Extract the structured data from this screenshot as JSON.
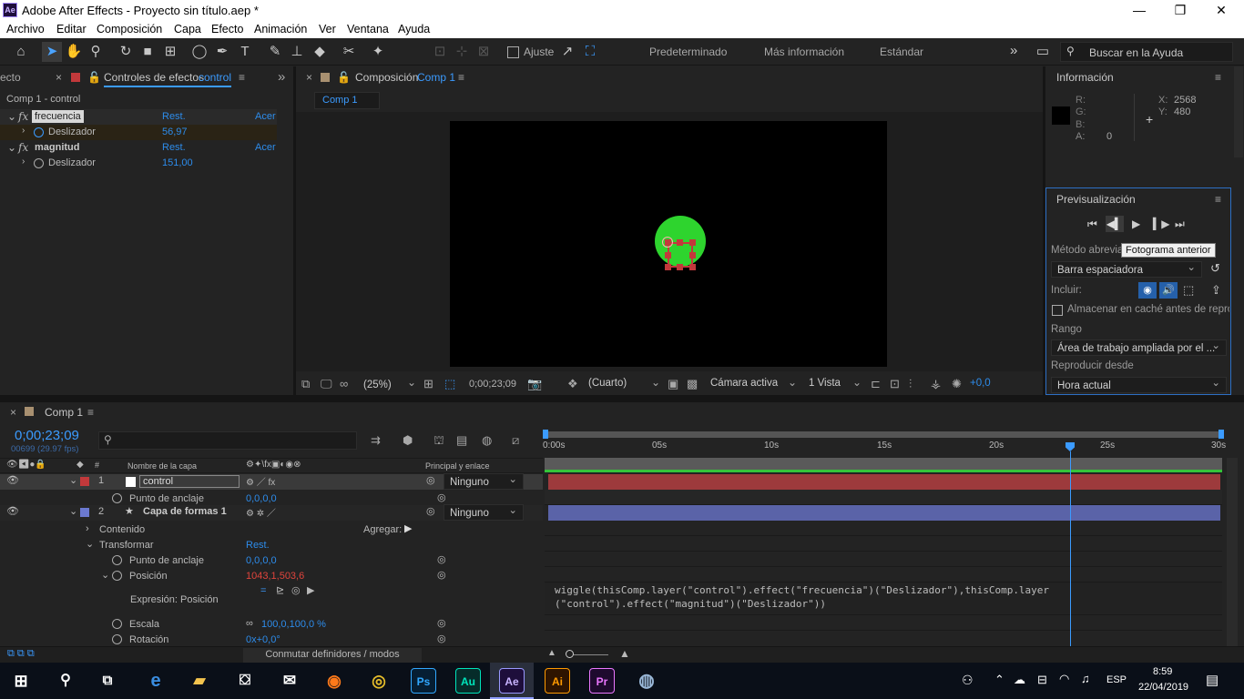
{
  "titlebar": {
    "logo": "Ae",
    "title": "Adobe After Effects - Proyecto sin título.aep *",
    "minimize": "—",
    "maximize": "❐",
    "close": "✕"
  },
  "menu": [
    "Archivo",
    "Editar",
    "Composición",
    "Capa",
    "Efecto",
    "Animación",
    "Ver",
    "Ventana",
    "Ayuda"
  ],
  "toolbar": {
    "snap_label": "Ajuste",
    "workspaces": [
      "Predeterminado",
      "Más información",
      "Estándar"
    ],
    "more": "»",
    "search_placeholder": "Buscar en la Ayuda"
  },
  "effects_panel": {
    "tab_left": "ecto",
    "tab_label": "Controles de efectos",
    "tab_layer": "control",
    "header": "Comp 1 - control",
    "effects": [
      {
        "name": "frecuencia",
        "reset": "Rest.",
        "about": "Acer",
        "param": "Deslizador",
        "value": "56,97"
      },
      {
        "name": "magnitud",
        "reset": "Rest.",
        "about": "Acer",
        "param": "Deslizador",
        "value": "151,00"
      }
    ]
  },
  "comp_panel": {
    "tab_label": "Composición",
    "tab_name": "Comp 1",
    "sub_tab": "Comp 1",
    "zoom": "(25%)",
    "timecode": "0;00;23;09",
    "resolution": "(Cuarto)",
    "camera": "Cámara activa",
    "views": "1 Vista",
    "exposure": "+0,0"
  },
  "info_panel": {
    "title": "Información",
    "r": "R:",
    "g": "G:",
    "b": "B:",
    "a": "A:",
    "a_val": "0",
    "x": "X:",
    "x_val": "2568",
    "y": "Y:",
    "y_val": "480"
  },
  "preview_panel": {
    "title": "Previsualización",
    "shortcut_label": "Método abrevia",
    "tooltip": "Fotograma anterior",
    "shortcut_value": "Barra espaciadora",
    "include_label": "Incluir:",
    "cache_label": "Almacenar en caché antes de reprodu",
    "range_label": "Rango",
    "range_value": "Área de trabajo ampliada por el ...",
    "play_from_label": "Reproducir desde",
    "play_from_value": "Hora actual"
  },
  "timeline": {
    "tab_name": "Comp 1",
    "timecode": "0;00;23;09",
    "fps": "00699 (29.97 fps)",
    "col_layer_name": "Nombre de la capa",
    "col_parent": "Principal y enlace",
    "ruler": [
      "0:00s",
      "05s",
      "10s",
      "15s",
      "20s",
      "25s",
      "30s"
    ],
    "layers": [
      {
        "num": "1",
        "name": "control",
        "parent": "Ninguno",
        "color": "#c2393b"
      },
      {
        "num": "2",
        "name": "Capa de formas 1",
        "parent": "Ninguno",
        "color": "#6b79d0"
      }
    ],
    "rows": {
      "anchor1": "Punto de anclaje",
      "anchor1_val": "0,0,0,0",
      "contents": "Contenido",
      "add": "Agregar:",
      "transform": "Transformar",
      "transform_reset": "Rest.",
      "anchor2": "Punto de anclaje",
      "anchor2_val": "0,0,0,0",
      "position": "Posición",
      "position_val": "1043,1,503,6",
      "expr_label": "Expresión: Posición",
      "scale": "Escala",
      "scale_val": "100,0,100,0 %",
      "rotation": "Rotación",
      "rotation_val": "0x+0,0°"
    },
    "expression": "wiggle(thisComp.layer(\"control\").effect(\"frecuencia\")(\"Deslizador\"),thisComp.layer\n(\"control\").effect(\"magnitud\")(\"Deslizador\"))",
    "toggle_label": "Conmutar definidores / modos"
  },
  "taskbar": {
    "apps": [
      "Ps",
      "Au",
      "Ae",
      "Ai",
      "Pr"
    ],
    "lang": "ESP",
    "time": "8:59",
    "date": "22/04/2019"
  }
}
